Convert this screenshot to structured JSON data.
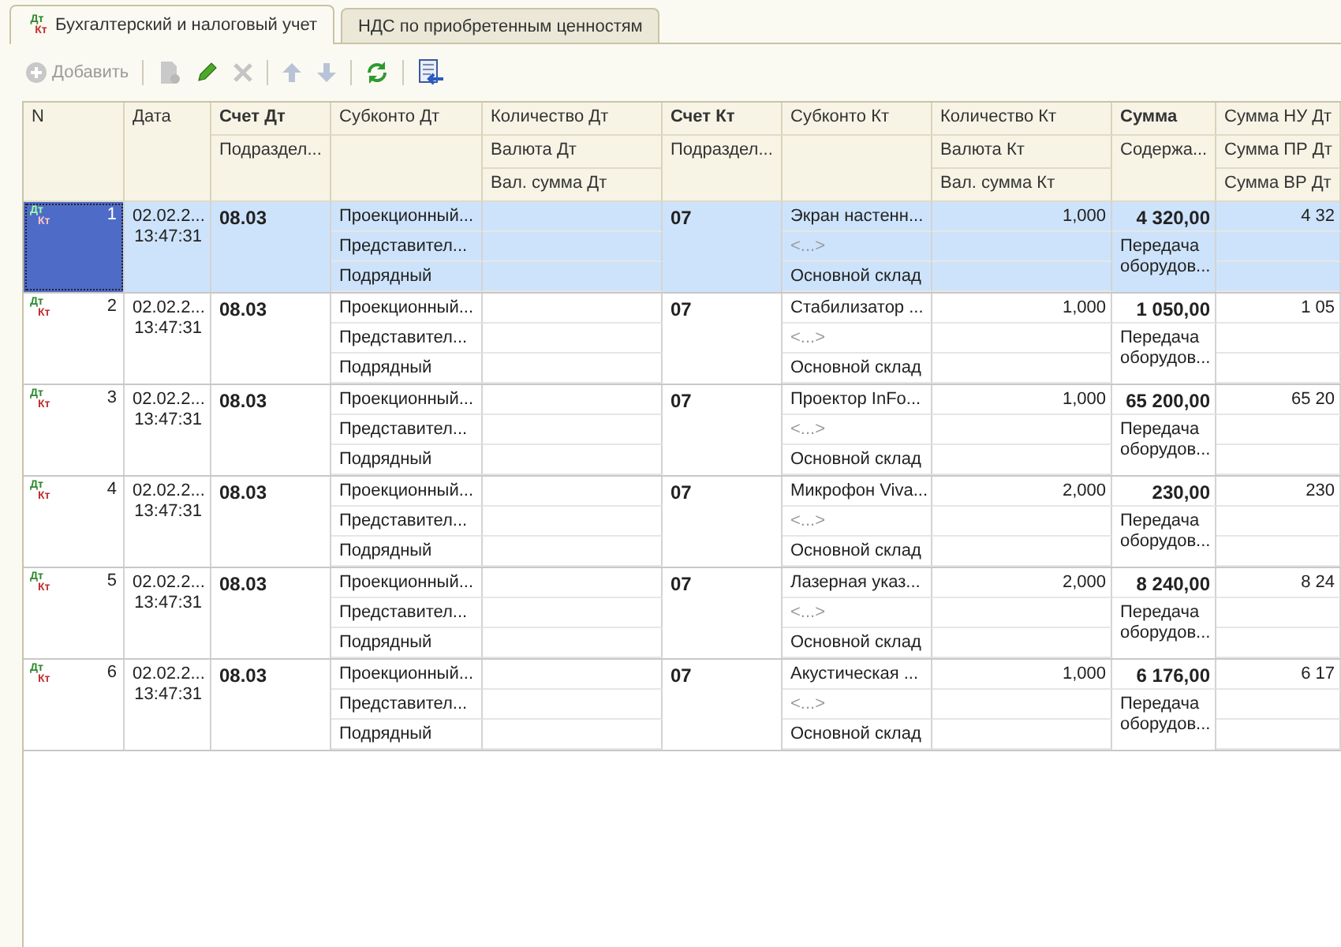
{
  "tabs": [
    {
      "label": "Бухгалтерский и налоговый учет",
      "selected": true,
      "mark_top": "Дт",
      "mark_bottom": "Кт"
    },
    {
      "label": "НДС по приобретенным ценностям",
      "selected": false
    }
  ],
  "toolbar": [
    {
      "kind": "add",
      "label": "Добавить",
      "disabled": true
    },
    {
      "kind": "copy",
      "disabled": true
    },
    {
      "kind": "edit",
      "disabled": false
    },
    {
      "kind": "delete",
      "disabled": true
    },
    {
      "kind": "up",
      "disabled": true
    },
    {
      "kind": "down",
      "disabled": true
    },
    {
      "kind": "refresh",
      "disabled": false
    },
    {
      "kind": "move",
      "disabled": false
    }
  ],
  "columns": [
    {
      "kind": "tall",
      "lines": [
        "N"
      ],
      "bold": false
    },
    {
      "kind": "tall",
      "lines": [
        "Дата"
      ],
      "bold": false
    },
    {
      "kind": "two",
      "lines": [
        "Счет Дт",
        "Подраздел..."
      ],
      "bold": true
    },
    {
      "kind": "two",
      "lines": [
        "Субконто Дт"
      ],
      "bold": false
    },
    {
      "kind": "three",
      "lines": [
        "Количество Дт",
        "Валюта Дт",
        "Вал. сумма Дт"
      ],
      "bold": false
    },
    {
      "kind": "two",
      "lines": [
        "Счет Кт",
        "Подраздел..."
      ],
      "bold": true
    },
    {
      "kind": "two",
      "lines": [
        "Субконто Кт"
      ],
      "bold": false
    },
    {
      "kind": "three",
      "lines": [
        "Количество Кт",
        "Валюта Кт",
        "Вал. сумма Кт"
      ],
      "bold": false
    },
    {
      "kind": "two",
      "lines": [
        "Сумма",
        "Содержа..."
      ],
      "bold": true
    },
    {
      "kind": "three",
      "lines": [
        "Сумма НУ Дт",
        "Сумма ПР Дт",
        "Сумма ВР Дт"
      ],
      "bold": false
    }
  ],
  "rows": [
    {
      "selected": true,
      "mark_top": "Дт",
      "mark_bottom": "Кт",
      "n": "1",
      "date": "02.02.2...",
      "time": "13:47:31",
      "account_dt": "08.03",
      "subkonto_dt": [
        "Проекционный...",
        "Представител...",
        "Подрядный"
      ],
      "account_kt": "07",
      "subkonto_kt": [
        {
          "text": "Экран настенн...",
          "muted": false
        },
        {
          "text": "<...>",
          "muted": true
        },
        {
          "text": "Основной склад",
          "muted": false
        }
      ],
      "qty_kt": "1,000",
      "sum": "4 320,00",
      "content": "Передача оборудов...",
      "sum_nu": "4 32"
    },
    {
      "selected": false,
      "mark_top": "Дт",
      "mark_bottom": "Кт",
      "n": "2",
      "date": "02.02.2...",
      "time": "13:47:31",
      "account_dt": "08.03",
      "subkonto_dt": [
        "Проекционный...",
        "Представител...",
        "Подрядный"
      ],
      "account_kt": "07",
      "subkonto_kt": [
        {
          "text": "Стабилизатор ...",
          "muted": false
        },
        {
          "text": "<...>",
          "muted": true
        },
        {
          "text": "Основной склад",
          "muted": false
        }
      ],
      "qty_kt": "1,000",
      "sum": "1 050,00",
      "content": "Передача оборудов...",
      "sum_nu": "1 05"
    },
    {
      "selected": false,
      "mark_top": "Дт",
      "mark_bottom": "Кт",
      "n": "3",
      "date": "02.02.2...",
      "time": "13:47:31",
      "account_dt": "08.03",
      "subkonto_dt": [
        "Проекционный...",
        "Представител...",
        "Подрядный"
      ],
      "account_kt": "07",
      "subkonto_kt": [
        {
          "text": "Проектор InFo...",
          "muted": false
        },
        {
          "text": "<...>",
          "muted": true
        },
        {
          "text": "Основной склад",
          "muted": false
        }
      ],
      "qty_kt": "1,000",
      "sum": "65 200,00",
      "content": "Передача оборудов...",
      "sum_nu": "65 20"
    },
    {
      "selected": false,
      "mark_top": "Дт",
      "mark_bottom": "Кт",
      "n": "4",
      "date": "02.02.2...",
      "time": "13:47:31",
      "account_dt": "08.03",
      "subkonto_dt": [
        "Проекционный...",
        "Представител...",
        "Подрядный"
      ],
      "account_kt": "07",
      "subkonto_kt": [
        {
          "text": "Микрофон Viva...",
          "muted": false
        },
        {
          "text": "<...>",
          "muted": true
        },
        {
          "text": "Основной склад",
          "muted": false
        }
      ],
      "qty_kt": "2,000",
      "sum": "230,00",
      "content": "Передача оборудов...",
      "sum_nu": "230"
    },
    {
      "selected": false,
      "mark_top": "Дт",
      "mark_bottom": "Кт",
      "n": "5",
      "date": "02.02.2...",
      "time": "13:47:31",
      "account_dt": "08.03",
      "subkonto_dt": [
        "Проекционный...",
        "Представител...",
        "Подрядный"
      ],
      "account_kt": "07",
      "subkonto_kt": [
        {
          "text": "Лазерная указ...",
          "muted": false
        },
        {
          "text": "<...>",
          "muted": true
        },
        {
          "text": "Основной склад",
          "muted": false
        }
      ],
      "qty_kt": "2,000",
      "sum": "8 240,00",
      "content": "Передача оборудов...",
      "sum_nu": "8 24"
    },
    {
      "selected": false,
      "mark_top": "Дт",
      "mark_bottom": "Кт",
      "n": "6",
      "date": "02.02.2...",
      "time": "13:47:31",
      "account_dt": "08.03",
      "subkonto_dt": [
        "Проекционный...",
        "Представител...",
        "Подрядный"
      ],
      "account_kt": "07",
      "subkonto_kt": [
        {
          "text": "Акустическая ...",
          "muted": false
        },
        {
          "text": "<...>",
          "muted": true
        },
        {
          "text": "Основной склад",
          "muted": false
        }
      ],
      "qty_kt": "1,000",
      "sum": "6 176,00",
      "content": "Передача оборудов...",
      "sum_nu": "6 17"
    }
  ]
}
